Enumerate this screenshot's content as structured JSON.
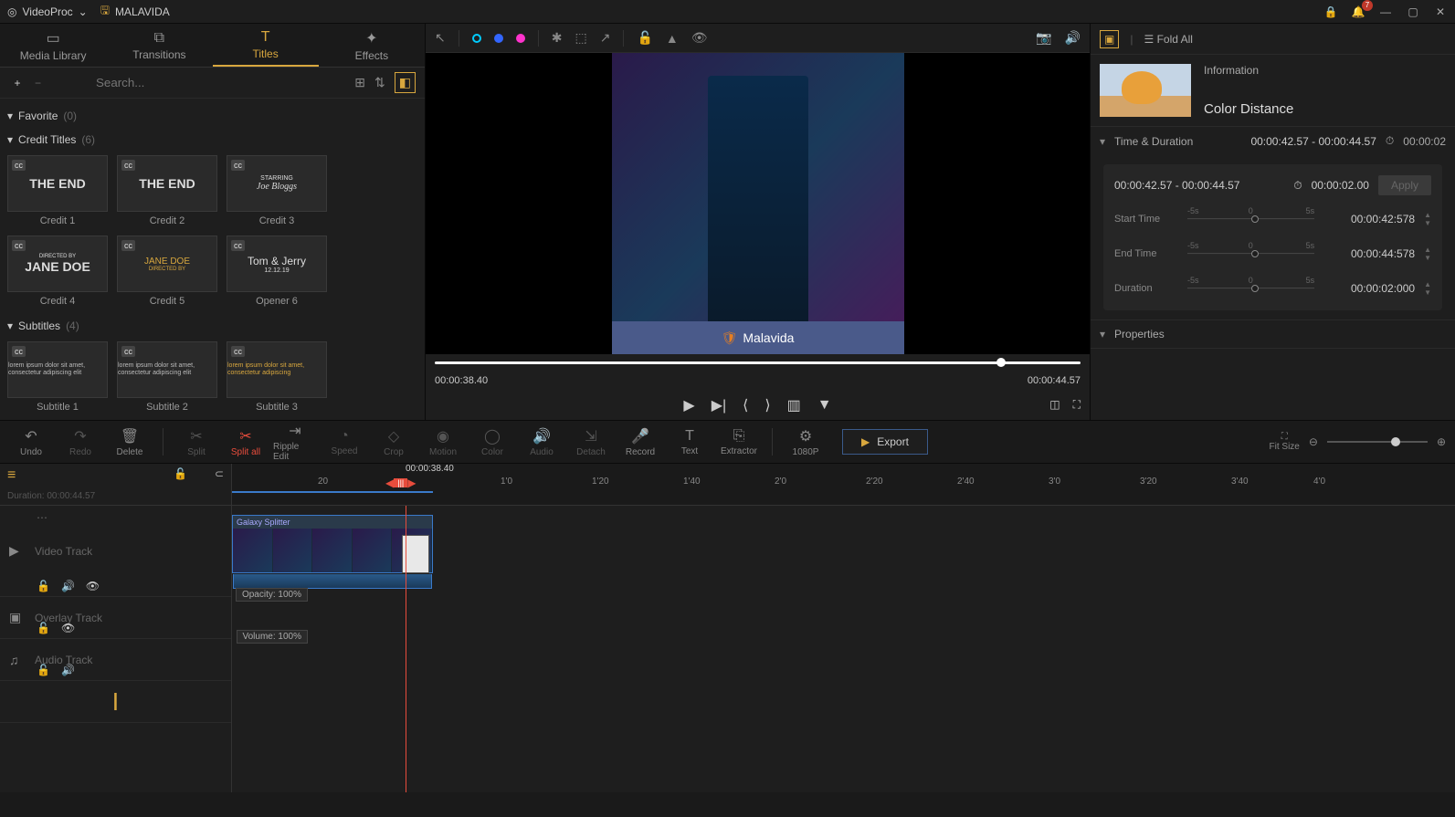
{
  "titlebar": {
    "app": "VideoProc",
    "project": "MALAVIDA",
    "notif_count": "7"
  },
  "left": {
    "tabs": [
      {
        "label": "Media Library"
      },
      {
        "label": "Transitions"
      },
      {
        "label": "Titles"
      },
      {
        "label": "Effects"
      }
    ],
    "search_placeholder": "Search...",
    "favorite": {
      "label": "Favorite",
      "count": "(0)"
    },
    "credit": {
      "label": "Credit Titles",
      "count": "(6)",
      "items": [
        {
          "label": "Credit 1",
          "thumb_big": "THE END"
        },
        {
          "label": "Credit 2",
          "thumb_big": "THE END"
        },
        {
          "label": "Credit 3",
          "thumb_top": "STARRING",
          "thumb_script": "Joe Bloggs"
        },
        {
          "label": "Credit 4",
          "thumb_top": "DIRECTED BY",
          "thumb_big": "JANE DOE"
        },
        {
          "label": "Credit 5",
          "thumb_big": "JANE DOE",
          "thumb_top2": "DIRECTED BY"
        },
        {
          "label": "Opener 6",
          "thumb_big": "Tom & Jerry",
          "thumb_sub": "12.12.19"
        }
      ]
    },
    "subtitles": {
      "label": "Subtitles",
      "count": "(4)",
      "items": [
        {
          "label": "Subtitle 1"
        },
        {
          "label": "Subtitle 2"
        },
        {
          "label": "Subtitle 3"
        }
      ]
    }
  },
  "preview": {
    "watermark": "Malavida",
    "cur_time": "00:00:38.40",
    "end_time": "00:00:44.57"
  },
  "right": {
    "fold_all": "Fold All",
    "info_label": "Information",
    "title": "Color Distance",
    "time_duration": {
      "label": "Time & Duration",
      "range": "00:00:42.57 - 00:00:44.57",
      "dur": "00:00:02"
    },
    "panel": {
      "range": "00:00:42.57 - 00:00:44.57",
      "dur": "00:00:02.00",
      "apply": "Apply",
      "start_label": "Start Time",
      "start_val": "00:00:42:578",
      "end_label": "End Time",
      "end_val": "00:00:44:578",
      "duration_label": "Duration",
      "duration_val": "00:00:02:000",
      "minus5": "-5s",
      "zero": "0",
      "plus5": "5s"
    },
    "properties": "Properties"
  },
  "toolbar": {
    "undo": "Undo",
    "redo": "Redo",
    "delete": "Delete",
    "split": "Split",
    "splitall": "Split all",
    "ripple": "Ripple Edit",
    "speed": "Speed",
    "crop": "Crop",
    "motion": "Motion",
    "color": "Color",
    "audio": "Audio",
    "detach": "Detach",
    "record": "Record",
    "text": "Text",
    "extractor": "Extractor",
    "quality": "1080P",
    "export": "Export",
    "fitsize": "Fit Size"
  },
  "timeline": {
    "playhead": "00:00:38.40",
    "duration": "Duration:   00:00:44.57",
    "video_track": "Video Track",
    "overlay_track": "Overlay Track",
    "audio_track": "Audio Track",
    "clip_name": "Galaxy Splitter",
    "opacity": "Opacity: 100%",
    "volume": "Volume: 100%",
    "marks": [
      "20",
      "1'0",
      "1'20",
      "1'40",
      "2'0",
      "2'20",
      "2'40",
      "3'0",
      "3'20",
      "3'40",
      "4'0"
    ]
  }
}
